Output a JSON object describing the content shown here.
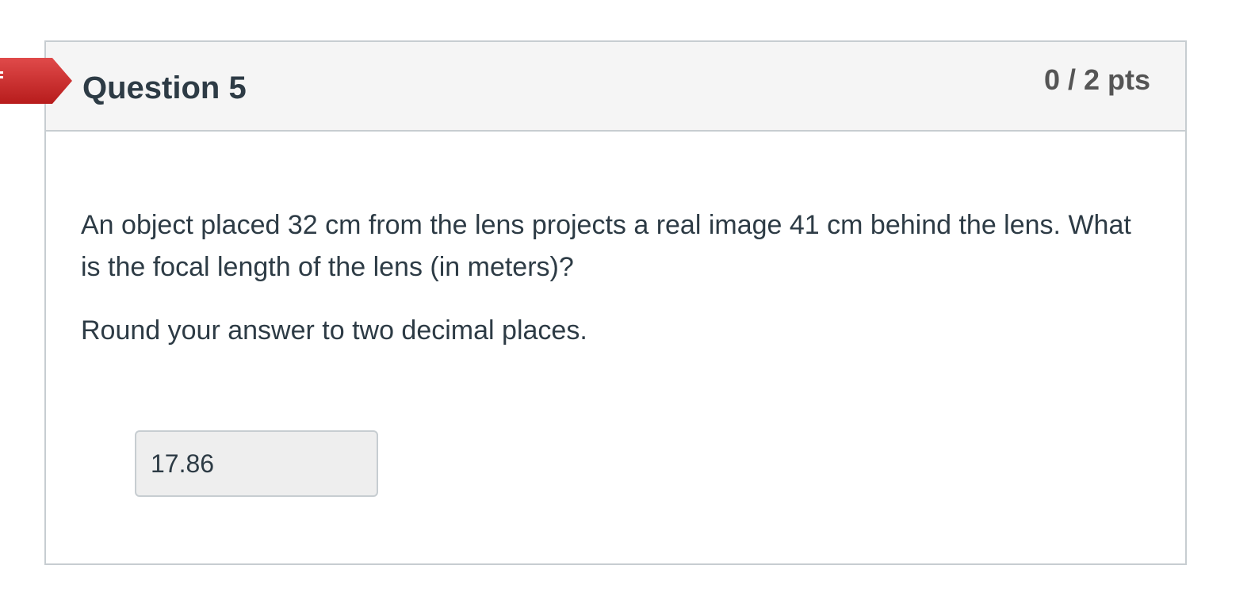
{
  "question": {
    "title": "Question 5",
    "points": "0 / 2 pts",
    "flag_icon": "incorrect-arrow-icon",
    "flag_color": "#d32f2f",
    "paragraphs": [
      "An object placed 32 cm from the lens projects a real image 41 cm behind the lens. What is the focal length of the lens (in meters)?",
      "Round your answer to two decimal places."
    ],
    "answer_value": "17.86"
  }
}
